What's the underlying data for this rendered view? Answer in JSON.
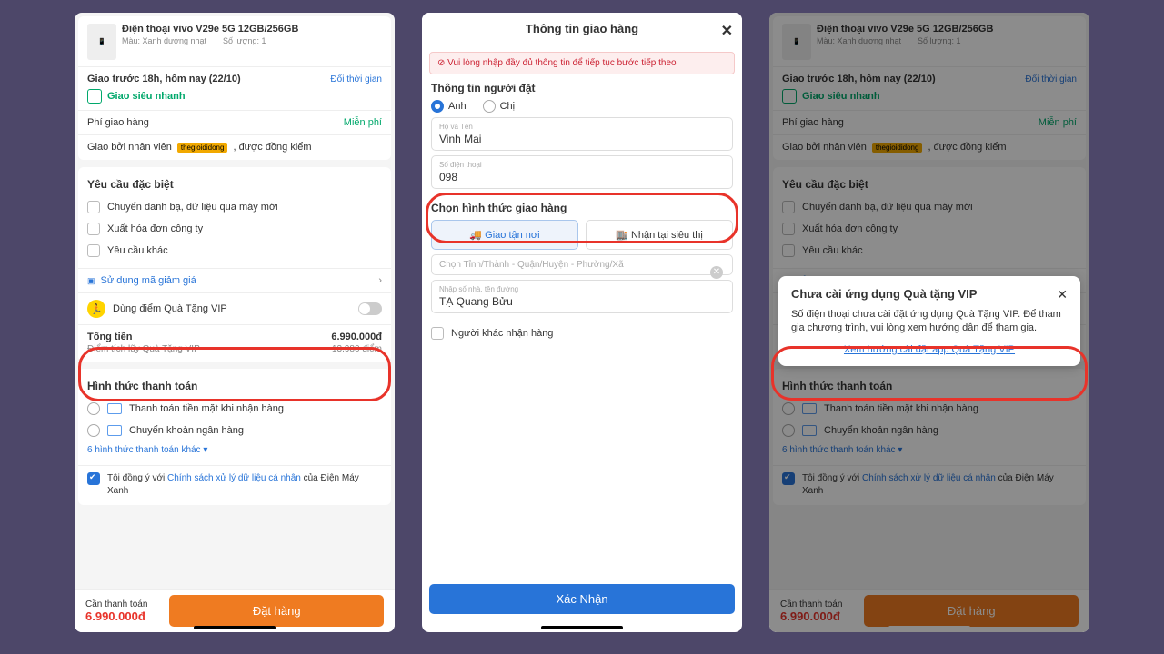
{
  "product": {
    "name": "Điện thoại vivo V29e 5G 12GB/256GB",
    "color_lbl": "Màu: Xanh dương nhạt",
    "qty_lbl": "Số lượng: 1"
  },
  "ship": {
    "headline": "Giao trước 18h, hôm nay (22/10)",
    "change": "Đổi thời gian",
    "fast": "Giao siêu nhanh",
    "fee_lbl": "Phí giao hàng",
    "fee_val": "Miễn phí",
    "staff_prefix": "Giao bởi nhân viên ",
    "staff_badge": "thegioididong",
    "staff_suffix": ", được đồng kiểm"
  },
  "special": {
    "heading": "Yêu cầu đặc biệt",
    "opt1": "Chuyển danh bạ, dữ liệu qua máy mới",
    "opt2": "Xuất hóa đơn công ty",
    "opt3": "Yêu cầu khác"
  },
  "promo": {
    "voucher": "Sử dụng mã giảm giá",
    "vip": "Dùng điểm Quà Tặng VIP",
    "subtotal_lbl": "Tổng tiền",
    "subtotal_val": "6.990.000đ",
    "points_lbl": "Điểm tích lũy Quà Tặng VIP",
    "points_val": "13.980 điểm"
  },
  "payment": {
    "heading": "Hình thức thanh toán",
    "cash": "Thanh toán tiền mặt khi nhận hàng",
    "bank": "Chuyển khoản ngân hàng",
    "more": "6 hình thức thanh toán khác "
  },
  "agree": {
    "prefix": "Tôi đồng ý với ",
    "policy": "Chính sách xử lý dữ liệu cá nhân",
    "suffix": " của Điện Máy Xanh"
  },
  "footer": {
    "due_lbl": "Cần thanh toán",
    "due_val": "6.990.000đ",
    "order_btn": "Đặt hàng"
  },
  "modal": {
    "title": "Thông tin giao hàng",
    "warning": "Vui lòng nhập đầy đủ thông tin để tiếp tục bước tiếp theo",
    "orderer_heading": "Thông tin người đặt",
    "salut_a": "Anh",
    "salut_b": "Chị",
    "name_lbl": "Họ và Tên",
    "name_val": "Vinh Mai",
    "phone_lbl": "Số điện thoại",
    "phone_val": "098",
    "method_heading": "Chọn hình thức giao hàng",
    "tab_deliver": "Giao tận nơi",
    "tab_pickup": "Nhận tại siêu thị",
    "loc_ph": "Chọn Tỉnh/Thành - Quận/Huyện - Phường/Xã",
    "addr_lbl": "Nhập số nhà, tên đường",
    "addr_val": "TẠ Quang Bửu",
    "other_recv": "Người khác nhận hàng",
    "confirm": "Xác Nhận"
  },
  "popup": {
    "title": "Chưa cài ứng dụng Quà tặng VIP",
    "body": "Số điện thoại chưa cài đặt ứng dụng Quà Tặng VIP. Để tham gia chương trình, vui lòng xem hướng dẫn để tham gia.",
    "link": "Xem hướng cài đặt app Quà Tặng VIP"
  }
}
